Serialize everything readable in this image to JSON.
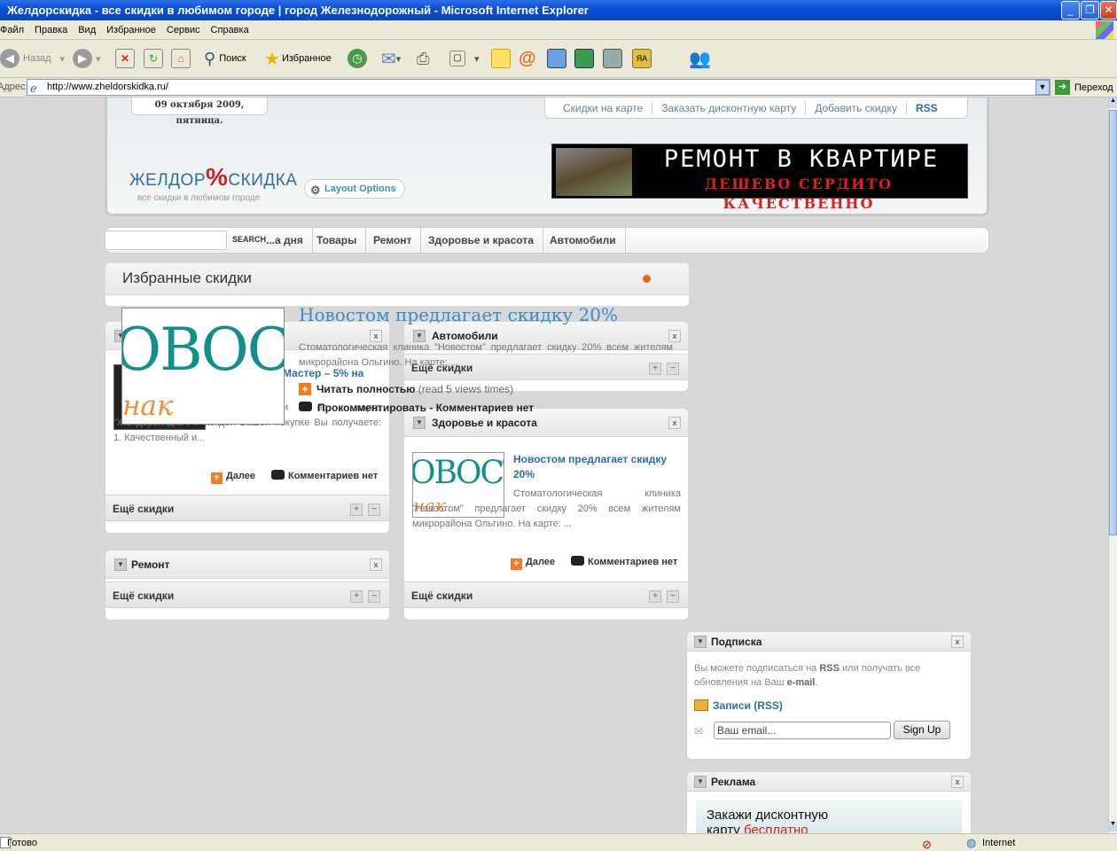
{
  "window": {
    "title": "Желдорскидка - все скидки в любимом городе | город Железнодорожный - Microsoft Internet Explorer"
  },
  "menu": [
    "Файл",
    "Правка",
    "Вид",
    "Избранное",
    "Сервис",
    "Справка"
  ],
  "toolbar": {
    "back": "Назад",
    "search": "Поиск",
    "favorites": "Избранное"
  },
  "address": {
    "label": "Адрес:",
    "url": "http://www.zheldorskidka.ru/",
    "go": "Переход"
  },
  "status": {
    "left": "Готово",
    "zone": "Internet"
  },
  "header": {
    "date": "09 октября 2009, пятница.",
    "links": [
      "Скидки на карте",
      "Заказать дисконтную карту",
      "Добавить скидку",
      "RSS"
    ],
    "logo_left": "ЖЕЛДОР",
    "logo_mark": "%",
    "logo_right": "СКИДКА",
    "logo_tagline": "все скидки в любимом городе",
    "layout_options": "Layout Options",
    "banner_line1": "РЕМОНТ В КВАРТИРЕ",
    "banner_line2": "ДЕШЕВО СЕРДИТО КАЧЕСТВЕННО"
  },
  "nav": {
    "search_btn": "SEARCH",
    "items": [
      "...а дня",
      "Товары",
      "Ремонт",
      "Здоровье и красота",
      "Автомобили"
    ]
  },
  "featured": {
    "title": "Избранные скидки",
    "overlay_title": "Новостом предлагает скидку 20%",
    "overlay_text": "Стоматологическая клиника \"Новостом\" предлагает скидку 20% всем жителям микрорайона Ольгино. На карте: ...",
    "read_more": "Читать полностью",
    "read_stats": "(read 5 views times)",
    "comment": "Прокомментировать - Комментариев нет"
  },
  "widget_left": {
    "post_link": "Мастер – 5% на",
    "post_text": "5% скидки по карте \"Желдорскидка\", к каждой Вашей покупке Вы получаете: 1. Качественный и...",
    "more": "Далее",
    "comments": "Комментариев нет",
    "footer": "Ещё скидки"
  },
  "widget_repair": {
    "title": "Ремонт",
    "footer": "Ещё скидки"
  },
  "widget_auto": {
    "title": "Автомобили",
    "footer": "Ещё скидки"
  },
  "widget_health": {
    "title": "Здоровье и красота",
    "post_link": "Новостом предлагает скидку 20%",
    "post_text": "Стоматологическая клиника \"Новостом\" предлагает скидку 20% всем жителям микрорайона Ольгино. На карте: ...",
    "more": "Далее",
    "comments": "Комментариев нет",
    "footer": "Ещё скидки"
  },
  "news_image": {
    "line1": "ОВОСТ",
    "line2": "нак заботы"
  },
  "subscribe": {
    "title": "Подписка",
    "text_a": "Вы можете подписаться на ",
    "text_rss": "RSS",
    "text_b": " или получать все обновления на Ваш ",
    "text_email": "e-mail",
    "text_c": ".",
    "rss_link": "Записи (RSS)",
    "email_value": "Ваш email...",
    "signup": "Sign Up"
  },
  "ads": {
    "title": "Реклама",
    "line1": "Закажи дисконтную",
    "line2a": "карту ",
    "line2b": "бесплатно"
  }
}
